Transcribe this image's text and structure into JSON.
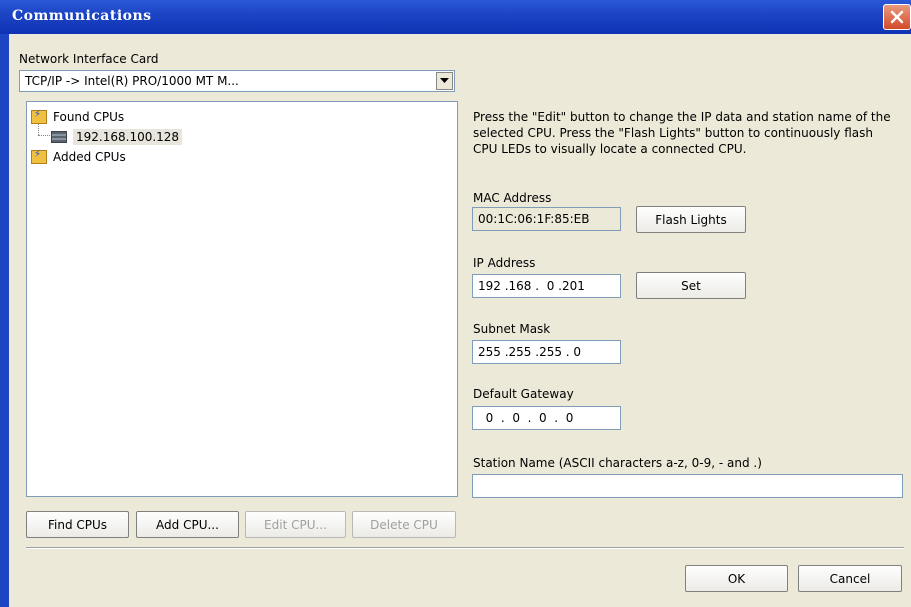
{
  "window": {
    "title": "Communications"
  },
  "nic": {
    "label": "Network Interface Card",
    "selected": "TCP/IP -> Intel(R) PRO/1000 MT M..."
  },
  "tree": {
    "found_label": "Found CPUs",
    "found_items": [
      "192.168.100.128"
    ],
    "added_label": "Added CPUs"
  },
  "description": "Press the \"Edit\" button to change the IP data and station name of the selected CPU. Press the \"Flash Lights\" button to continuously flash CPU LEDs to visually locate a connected CPU.",
  "mac": {
    "label": "MAC Address",
    "value": "00:1C:06:1F:85:EB",
    "flash_button": "Flash Lights"
  },
  "ip": {
    "label": "IP Address",
    "value": "192 .168 .  0 .201",
    "set_button": "Set"
  },
  "subnet": {
    "label": "Subnet Mask",
    "value": "255 .255 .255 . 0"
  },
  "gateway": {
    "label": "Default Gateway",
    "value": "  0  .  0  .  0  .  0"
  },
  "station": {
    "label": "Station Name (ASCII characters a-z, 0-9, - and .)",
    "value": ""
  },
  "buttons": {
    "find": "Find CPUs",
    "add": "Add CPU...",
    "edit": "Edit CPU...",
    "delete": "Delete CPU",
    "ok": "OK",
    "cancel": "Cancel"
  },
  "colors": {
    "titlebar": "#1c45c4",
    "close": "#d34b2a",
    "dialog_bg": "#ece9d8"
  }
}
